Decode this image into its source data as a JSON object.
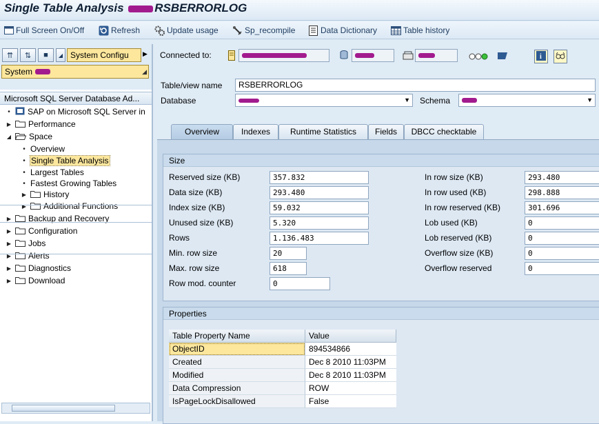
{
  "window": {
    "title_prefix": "Single Table Analysis",
    "title_table": "RSBERRORLOG"
  },
  "toolbar": {
    "buttons": [
      {
        "label": "Full Screen On/Off",
        "icon": "fullscreen-icon"
      },
      {
        "label": "Refresh",
        "icon": "refresh-icon"
      },
      {
        "label": "Update usage",
        "icon": "gears-icon"
      },
      {
        "label": "Sp_recompile",
        "icon": "wrench-icon"
      },
      {
        "label": "Data Dictionary",
        "icon": "dictionary-icon"
      },
      {
        "label": "Table history",
        "icon": "table-icon"
      }
    ]
  },
  "left": {
    "system_config_label": "System Configu",
    "system_label": "System",
    "tree_header": "Microsoft SQL Server Database Ad...",
    "tree": [
      {
        "label": "SAP on Microsoft SQL Server in",
        "type": "doc",
        "indent": 0
      },
      {
        "label": "Performance",
        "type": "folder",
        "indent": 0
      },
      {
        "label": "Space",
        "type": "folder-open",
        "indent": 0
      },
      {
        "label": "Overview",
        "type": "leaf",
        "indent": 1
      },
      {
        "label": "Single Table Analysis",
        "type": "leaf",
        "indent": 1
      },
      {
        "label": "Largest Tables",
        "type": "leaf",
        "indent": 1
      },
      {
        "label": "Fastest Growing Tables",
        "type": "leaf",
        "indent": 1
      },
      {
        "label": "History",
        "type": "folder",
        "indent": 1
      },
      {
        "label": "Additional Functions",
        "type": "folder",
        "indent": 1
      },
      {
        "label": "Backup and Recovery",
        "type": "folder",
        "indent": 0
      },
      {
        "label": "Configuration",
        "type": "folder",
        "indent": 0
      },
      {
        "label": "Jobs",
        "type": "folder",
        "indent": 0
      },
      {
        "label": "Alerts",
        "type": "folder",
        "indent": 0
      },
      {
        "label": "Diagnostics",
        "type": "folder",
        "indent": 0
      },
      {
        "label": "Download",
        "type": "folder",
        "indent": 0
      }
    ]
  },
  "connection": {
    "label": "Connected to:"
  },
  "form": {
    "table_view_label": "Table/view name",
    "table_view_value": "RSBERRORLOG",
    "database_label": "Database",
    "schema_label": "Schema"
  },
  "tabs": [
    "Overview",
    "Indexes",
    "Runtime Statistics",
    "Fields",
    "DBCC checktable"
  ],
  "size": {
    "title": "Size",
    "left": [
      {
        "label": "Reserved size (KB)",
        "value": "357.832"
      },
      {
        "label": "Data size (KB)",
        "value": "293.480"
      },
      {
        "label": "Index size (KB)",
        "value": "59.032"
      },
      {
        "label": "Unused size (KB)",
        "value": "5.320"
      },
      {
        "label": "Rows",
        "value": "1.136.483"
      },
      {
        "label": "Min. row size",
        "value": "20"
      },
      {
        "label": "Max. row size",
        "value": "618"
      },
      {
        "label": "Row mod. counter",
        "value": "0"
      }
    ],
    "right": [
      {
        "label": "In row size (KB)",
        "value": "293.480"
      },
      {
        "label": "In row used (KB)",
        "value": "298.888"
      },
      {
        "label": "In row reserved (KB)",
        "value": "301.696"
      },
      {
        "label": "Lob used (KB)",
        "value": "0"
      },
      {
        "label": "Lob reserved (KB)",
        "value": "0"
      },
      {
        "label": "Overflow size (KB)",
        "value": "0"
      },
      {
        "label": "Overflow reserved",
        "value": "0"
      }
    ]
  },
  "properties": {
    "title": "Properties",
    "columns": [
      "Table Property Name",
      "Value"
    ],
    "rows": [
      [
        "ObjectID",
        "894534866"
      ],
      [
        "Created",
        "Dec  8 2010 11:03PM"
      ],
      [
        "Modified",
        "Dec  8 2010 11:03PM"
      ],
      [
        "Data Compression",
        "ROW"
      ],
      [
        "IsPageLockDisallowed",
        "False"
      ]
    ]
  }
}
